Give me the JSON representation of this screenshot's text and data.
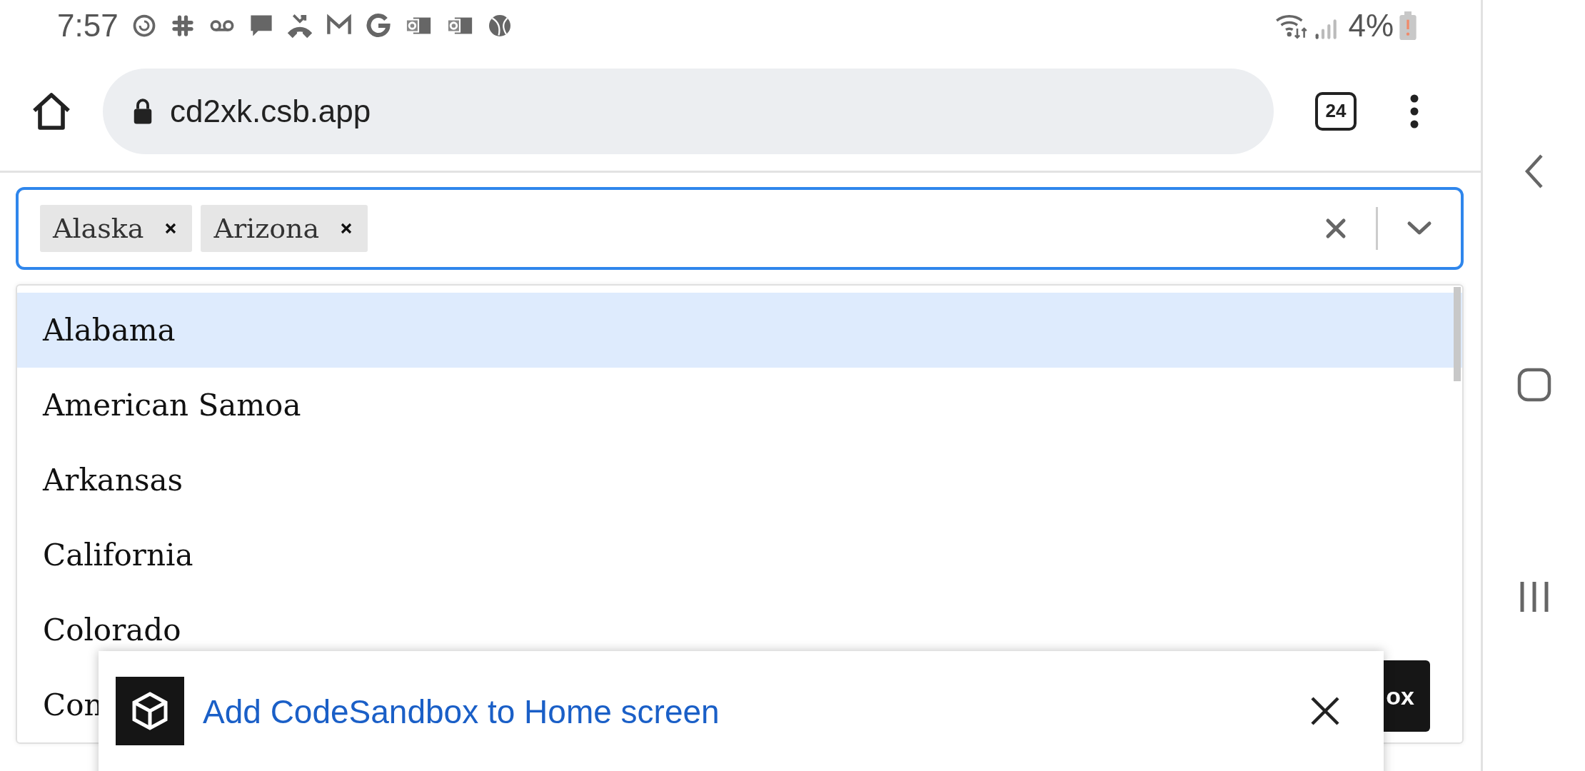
{
  "status_bar": {
    "time": "7:57",
    "battery": "4%"
  },
  "browser": {
    "url": "cd2xk.csb.app",
    "tab_count": "24"
  },
  "select": {
    "tags": [
      {
        "label": "Alaska"
      },
      {
        "label": "Arizona"
      }
    ],
    "options": [
      {
        "label": "Alabama",
        "selected": true
      },
      {
        "label": "American Samoa",
        "selected": false
      },
      {
        "label": "Arkansas",
        "selected": false
      },
      {
        "label": "California",
        "selected": false
      },
      {
        "label": "Colorado",
        "selected": false
      },
      {
        "label": "Con",
        "selected": false
      }
    ]
  },
  "page_button": {
    "label": "ox"
  },
  "banner": {
    "text": "Add CodeSandbox to Home screen"
  }
}
